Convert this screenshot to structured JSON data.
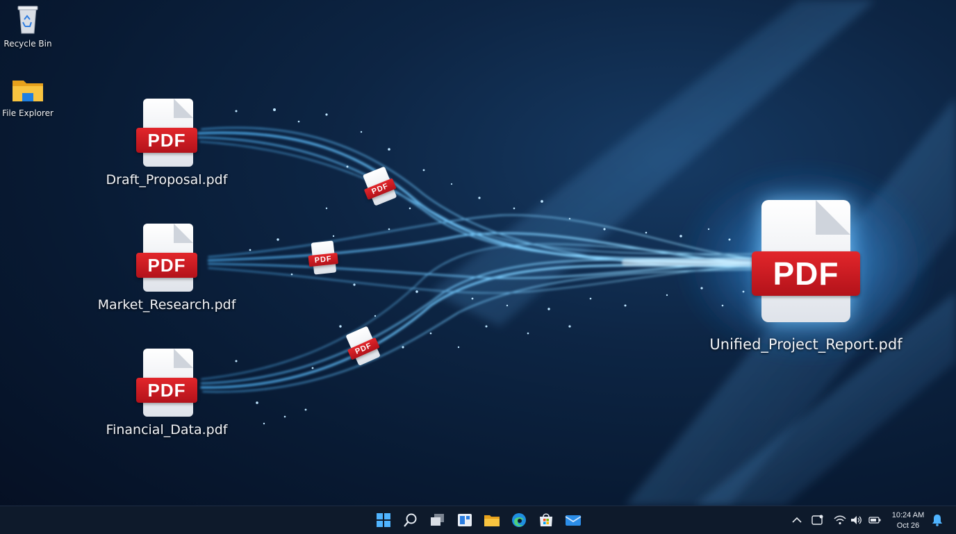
{
  "desktop": {
    "shortcuts": [
      {
        "label": "Recycle Bin",
        "icon": "recycle-bin-icon"
      },
      {
        "label": "File Explorer",
        "icon": "folder-icon"
      }
    ],
    "source_files": [
      {
        "name": "Draft_Proposal.pdf",
        "badge": "PDF"
      },
      {
        "name": "Market_Research.pdf",
        "badge": "PDF"
      },
      {
        "name": "Financial_Data.pdf",
        "badge": "PDF"
      }
    ],
    "flying_badge": "PDF",
    "result_file": {
      "name": "Unified_Project_Report.pdf",
      "badge": "PDF"
    }
  },
  "taskbar": {
    "pinned": [
      {
        "icon": "windows-start-icon"
      },
      {
        "icon": "search-icon"
      },
      {
        "icon": "task-view-icon"
      },
      {
        "icon": "widgets-icon"
      },
      {
        "icon": "file-explorer-icon"
      },
      {
        "icon": "edge-browser-icon"
      },
      {
        "icon": "microsoft-store-icon"
      },
      {
        "icon": "mail-icon"
      }
    ],
    "tray": {
      "icons": [
        "chevron-up-icon",
        "device-icon",
        "wifi-icon",
        "volume-icon",
        "battery-icon",
        "notification-bell-icon"
      ],
      "time": "10:24 AM",
      "date": "Oct 26"
    }
  },
  "colors": {
    "accent_blue": "#3aa8ff",
    "pdf_red": "#c8161d",
    "taskbar_bg": "#0e1a2b"
  }
}
